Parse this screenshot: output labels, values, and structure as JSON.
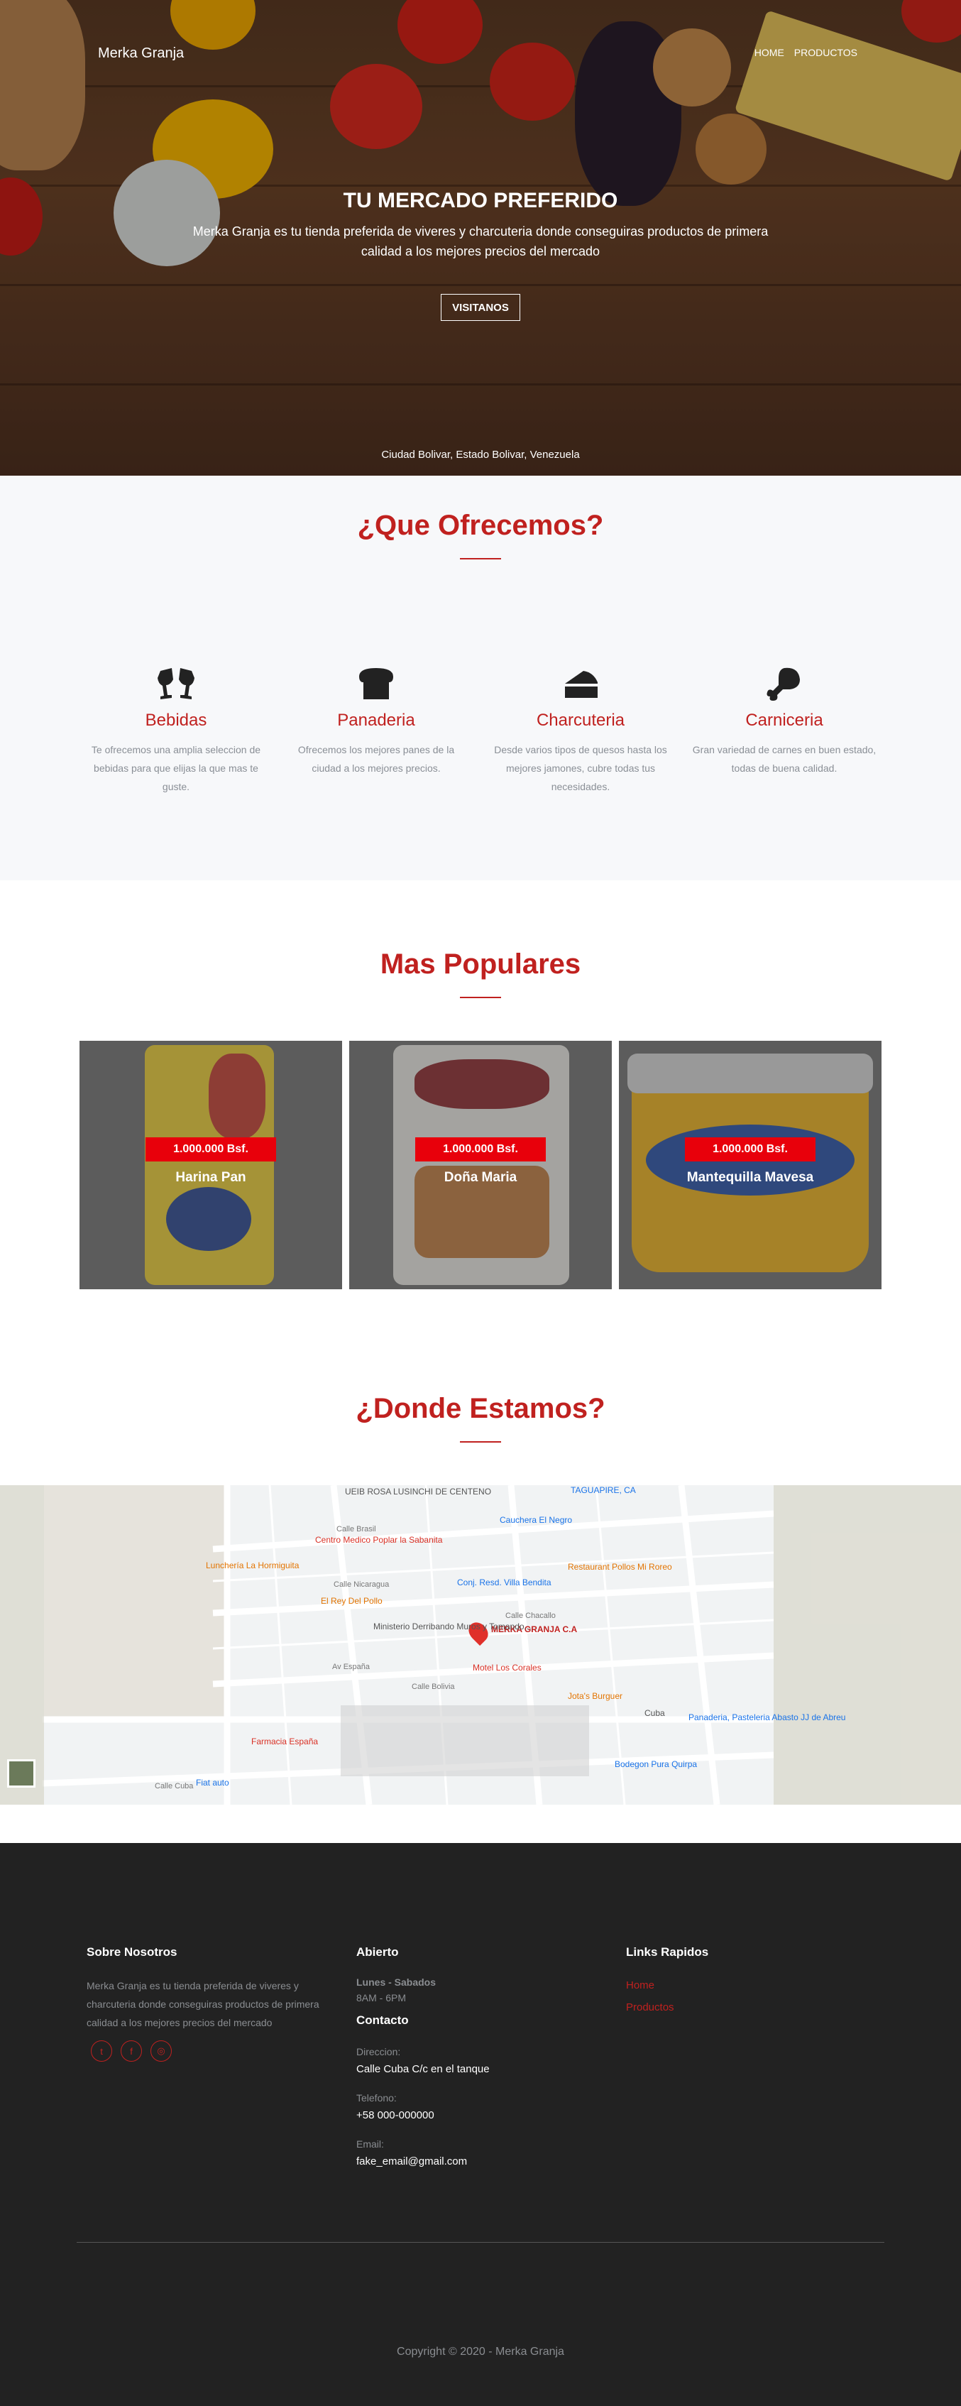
{
  "header": {
    "brand": "Merka Granja",
    "nav": [
      "HOME",
      "PRODUCTOS"
    ]
  },
  "hero": {
    "title": "TU MERCADO PREFERIDO",
    "subtitle": "Merka Granja es tu tienda preferida de viveres y charcuteria donde conseguiras productos de primera calidad a los mejores precios del mercado",
    "button": "VISITANOS",
    "location": "Ciudad Bolivar, Estado Bolivar, Venezuela"
  },
  "offer": {
    "title": "¿Que Ofrecemos?",
    "services": [
      {
        "icon": "glasses-cheers-icon",
        "title": "Bebidas",
        "text": "Te ofrecemos una amplia seleccion de bebidas para que elijas la que mas te guste."
      },
      {
        "icon": "bread-slice-icon",
        "title": "Panaderia",
        "text": "Ofrecemos los mejores panes de la ciudad a los mejores precios."
      },
      {
        "icon": "cheese-icon",
        "title": "Charcuteria",
        "text": "Desde varios tipos de quesos hasta los mejores jamones, cubre todas tus necesidades."
      },
      {
        "icon": "drumstick-icon",
        "title": "Carniceria",
        "text": "Gran variedad de carnes en buen estado, todas de buena calidad."
      }
    ]
  },
  "popular": {
    "title": "Mas Populares",
    "products": [
      {
        "name": "Harina Pan",
        "price": "1.000.000 Bsf."
      },
      {
        "name": "Doña Maria",
        "price": "1.000.000 Bsf."
      },
      {
        "name": "Mantequilla Mavesa",
        "price": "1.000.000 Bsf."
      }
    ]
  },
  "where": {
    "title": "¿Donde Estamos?",
    "map_labels": {
      "main": "MERKA GRANJA C.A",
      "places": [
        "UEIB ROSA LUSINCHI DE CENTENO",
        "TAGUAPIRE, CA",
        "Centro Medico Poplar la Sabanita",
        "Cauchera El Negro",
        "Lunchería La Hormiguita",
        "Conj. Resd. Villa Bendita",
        "Restaurant Pollos Mi Roreo",
        "El Rey Del Pollo",
        "Ministerio Derribando Muros y Tomando...",
        "Motel Los Corales",
        "Jota's Burguer",
        "Farmacia España",
        "Panaderia, Pasteleria Abasto JJ de Abreu",
        "Bodegon Pura Quirpa",
        "Fiat auto"
      ],
      "streets": [
        "Calle Brasil",
        "Calle Nicaragua",
        "Calle Chacallo",
        "Av España",
        "Calle Bolivia",
        "Cuba",
        "Calle Cuba"
      ]
    }
  },
  "footer": {
    "about": {
      "title": "Sobre Nosotros",
      "text": "Merka Granja es tu tienda preferida de viveres y charcuteria donde conseguiras productos de primera calidad a los mejores precios del mercado",
      "social": [
        "twitter-icon",
        "facebook-icon",
        "instagram-icon"
      ]
    },
    "open": {
      "title": "Abierto",
      "days": "Lunes - Sabados",
      "hours": "8AM - 6PM"
    },
    "contact": {
      "title": "Contacto",
      "address_label": "Direccion:",
      "address": "Calle Cuba C/c en el tanque",
      "phone_label": "Telefono:",
      "phone": "+58 000-000000",
      "email_label": "Email:",
      "email": "fake_email@gmail.com"
    },
    "links": {
      "title": "Links Rapidos",
      "items": [
        "Home",
        "Productos"
      ]
    },
    "copyright": "Copyright © 2020 - Merka Granja"
  }
}
